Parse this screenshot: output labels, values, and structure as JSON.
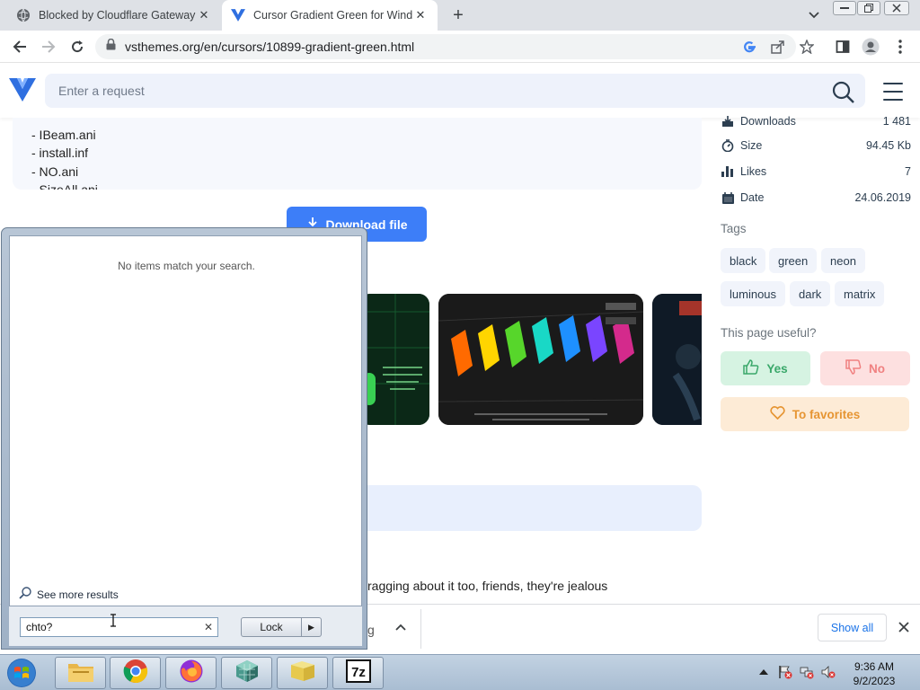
{
  "browser": {
    "tabs": [
      {
        "title": "Blocked by Cloudflare Gateway",
        "active": false,
        "icon": "globe-icon"
      },
      {
        "title": "Cursor Gradient Green for Windows",
        "active": true,
        "icon": "vsthemes-logo-icon"
      }
    ],
    "url": "vsthemes.org/en/cursors/10899-gradient-green.html"
  },
  "site": {
    "search_placeholder": "Enter a request"
  },
  "file_list": [
    "- IBeam.ani",
    "- install.inf",
    "- NO.ani",
    "- SizeAll.ani"
  ],
  "download_button": "Download file",
  "sidebar": {
    "info": [
      {
        "label": "Downloads",
        "value": "1 481",
        "icon": "download-icon"
      },
      {
        "label": "Size",
        "value": "94.45 Kb",
        "icon": "scale-icon"
      },
      {
        "label": "Likes",
        "value": "7",
        "icon": "bar-chart-icon"
      },
      {
        "label": "Date",
        "value": "24.06.2019",
        "icon": "calendar-icon"
      }
    ],
    "tags_heading": "Tags",
    "tags": [
      "black",
      "green",
      "neon",
      "luminous",
      "dark",
      "matrix"
    ],
    "useful_heading": "This page useful?",
    "yes_label": "Yes",
    "no_label": "No",
    "favorites_label": "To favorites"
  },
  "comment_snippet": "ragging about it too, friends, they're jealous",
  "download_shelf": {
    "partial_item": "g",
    "show_all": "Show all"
  },
  "start_menu": {
    "no_items": "No items match your search.",
    "see_more": "See more results",
    "search_value": "chto?",
    "lock_label": "Lock"
  },
  "taskbar": {
    "time": "9:36 AM",
    "date": "9/2/2023",
    "apps": [
      "file-explorer-icon",
      "chrome-icon",
      "firefox-icon",
      "network-cube-icon",
      "folder-icon",
      "7zip-icon"
    ]
  },
  "colors": {
    "accent": "#3d7ef8",
    "yes_green": "#3aa86a",
    "no_red": "#f08080",
    "favorites_orange": "#e69533"
  }
}
